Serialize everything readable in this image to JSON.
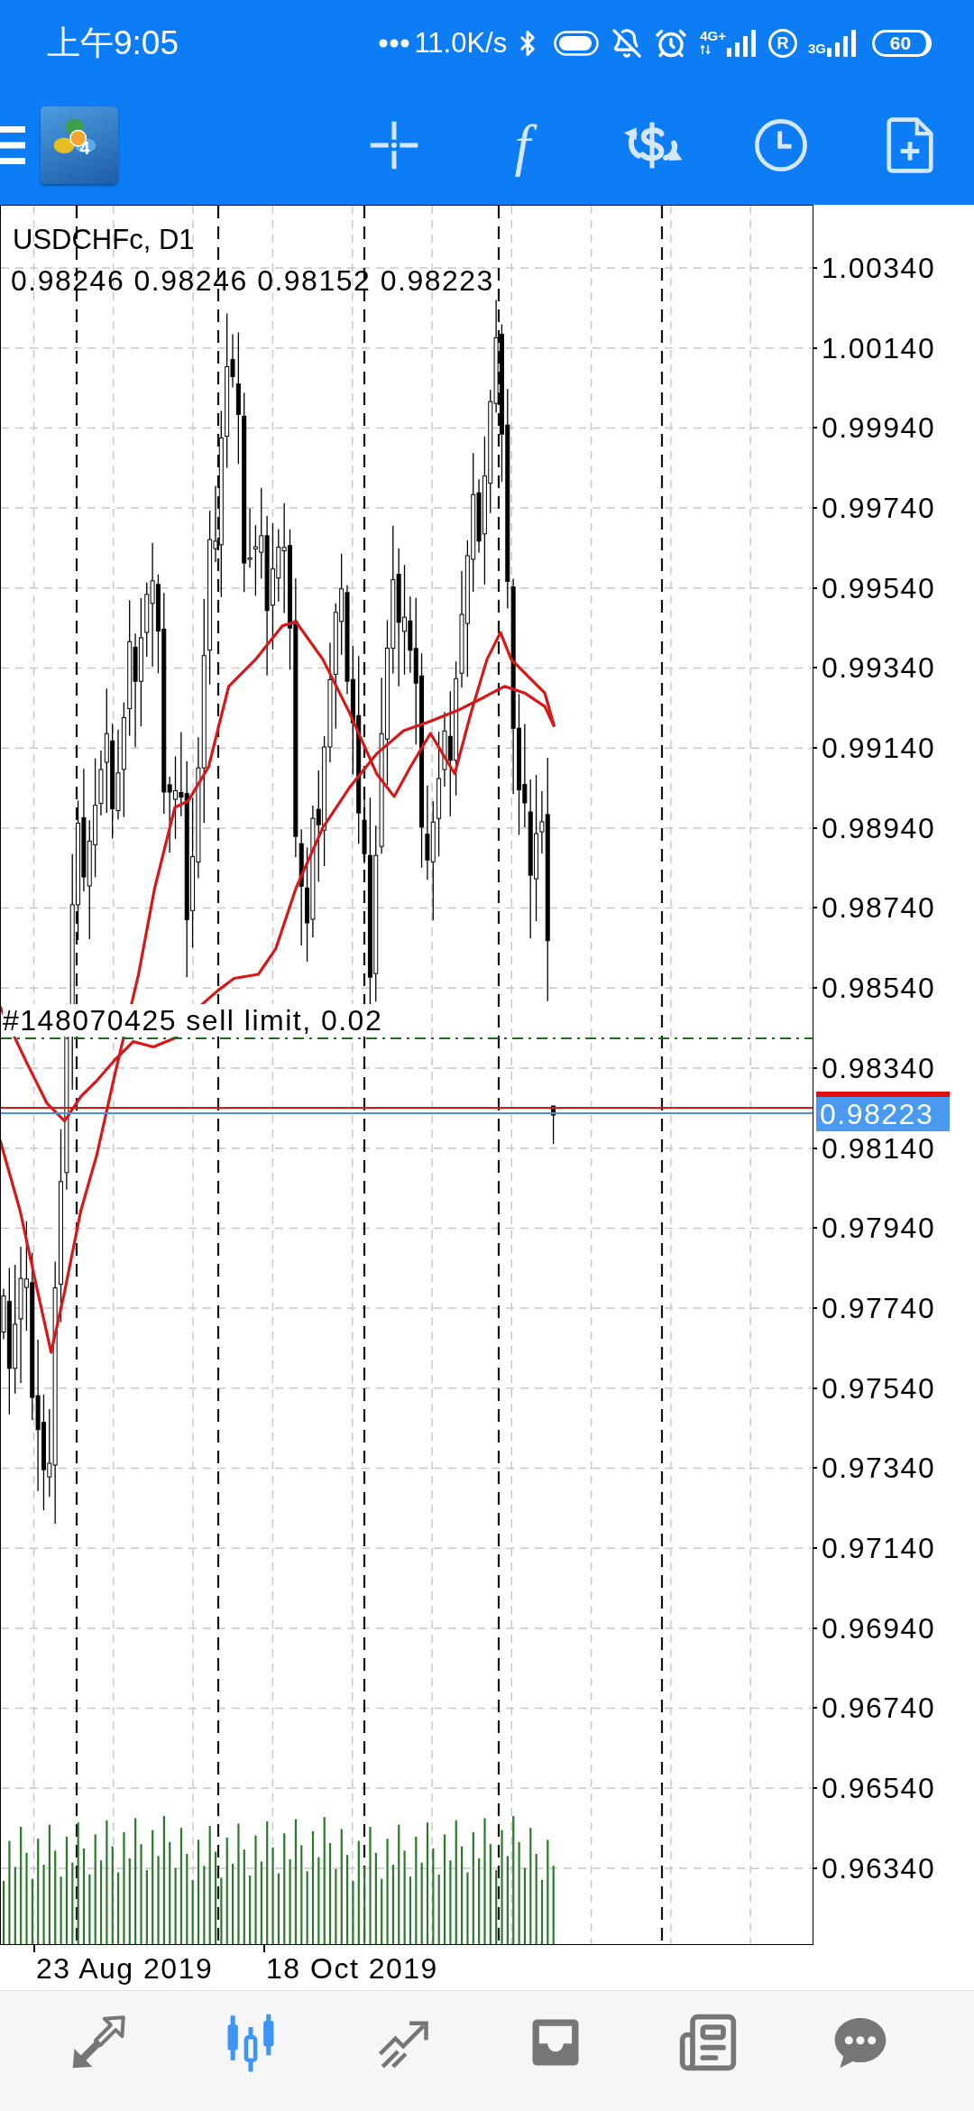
{
  "status_bar": {
    "time": "上午9:05",
    "net_speed": "11.0K/s",
    "signal_1_type": "4G+",
    "roaming": "R",
    "signal_2_type": "3G",
    "battery": "60"
  },
  "toolbar": {
    "logo_badge": "4",
    "function_glyph": "f"
  },
  "chart": {
    "symbol": "USDCHFc, D1",
    "ohlc": "0.98246 0.98246 0.98152 0.98223",
    "order_label": "#148070425 sell limit, 0.02",
    "price_ticks": [
      "1.00340",
      "1.00140",
      "0.99940",
      "0.99740",
      "0.99540",
      "0.99340",
      "0.99140",
      "0.98940",
      "0.98740",
      "0.98540",
      "0.98340",
      "0.98140",
      "0.97940",
      "0.97740",
      "0.97540",
      "0.97340",
      "0.97140",
      "0.96940",
      "0.96740",
      "0.96540",
      "0.96340"
    ],
    "current_price": "0.98223",
    "date_labels": [
      "23 Aug 2019",
      "18 Oct 2019"
    ]
  },
  "bottom_nav": [
    {
      "selected": false
    },
    {
      "selected": true
    },
    {
      "selected": false
    },
    {
      "selected": false
    },
    {
      "selected": false
    },
    {
      "selected": false
    }
  ]
}
